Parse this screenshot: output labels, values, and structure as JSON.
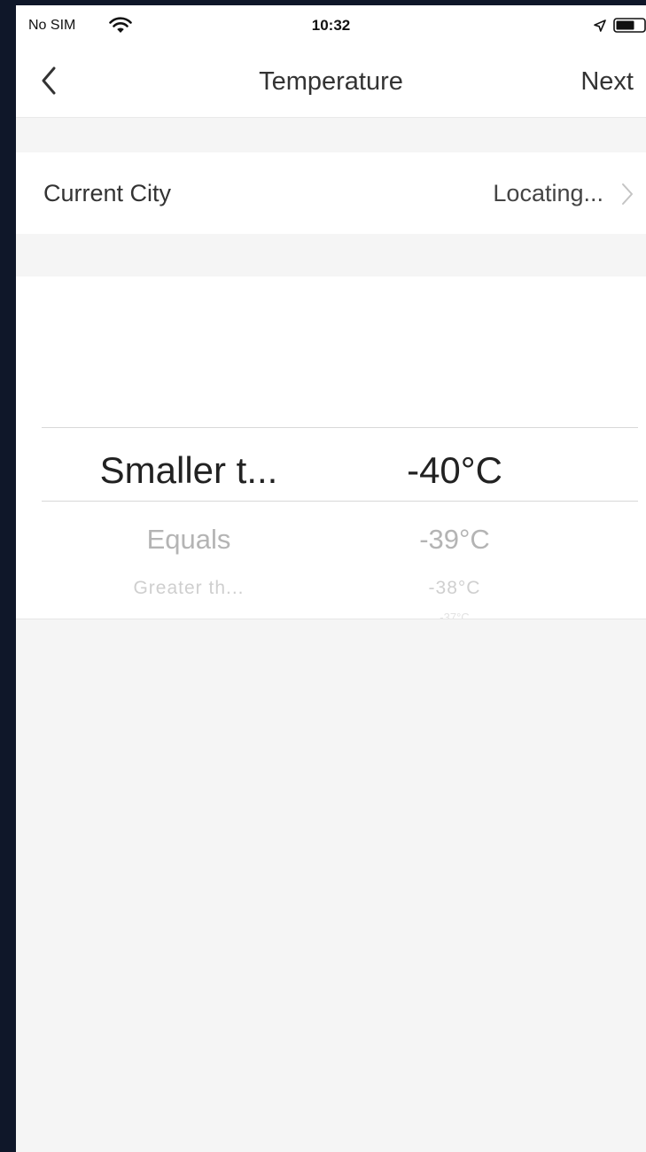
{
  "status_bar": {
    "carrier": "No SIM",
    "time": "10:32",
    "icons": [
      "wifi-icon",
      "location-arrow-icon",
      "battery-icon"
    ]
  },
  "nav": {
    "back_icon": "chevron-left-icon",
    "title": "Temperature",
    "next_label": "Next"
  },
  "city": {
    "label": "Current City",
    "value": "Locating...",
    "chevron_icon": "chevron-right-icon"
  },
  "picker": {
    "conditions": [
      "Smaller t...",
      "Equals",
      "Greater th..."
    ],
    "temperatures": [
      "-40°C",
      "-39°C",
      "-38°C",
      "-37°C"
    ],
    "selected_condition": "Smaller t...",
    "selected_temperature": "-40°C"
  },
  "colors": {
    "background": "#f5f5f5",
    "surface": "#ffffff",
    "text_primary": "#333333",
    "text_faded": "#b4b4b4",
    "outer_frame": "#0f1729"
  }
}
